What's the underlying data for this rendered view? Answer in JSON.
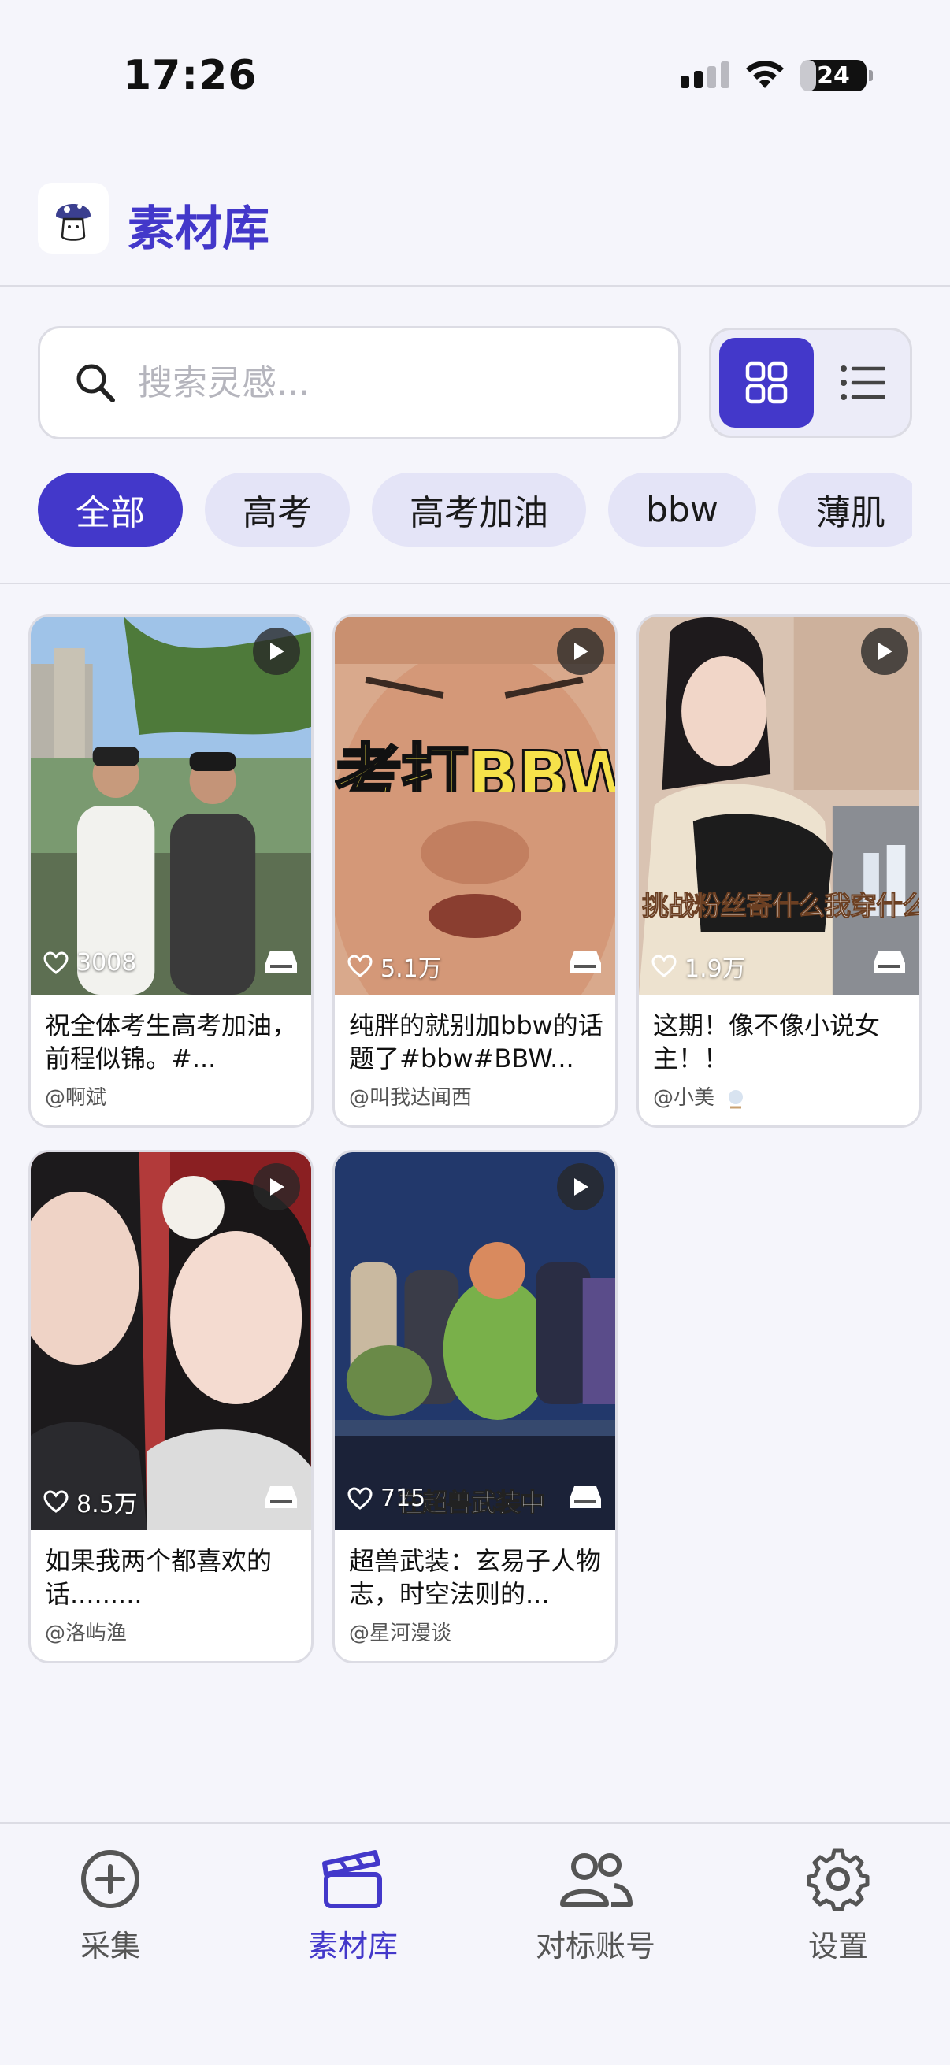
{
  "status_bar": {
    "time": "17:26",
    "battery": "24",
    "battery_level": 0.24
  },
  "header": {
    "title": "素材库"
  },
  "search": {
    "placeholder": "搜索灵感..."
  },
  "filters": [
    {
      "label": "全部",
      "active": true
    },
    {
      "label": "高考",
      "active": false
    },
    {
      "label": "高考加油",
      "active": false
    },
    {
      "label": "bbw",
      "active": false
    },
    {
      "label": "薄肌",
      "active": false
    }
  ],
  "cards": [
    {
      "likes": "3008",
      "title": "祝全体考生高考加油，前程似锦。#...",
      "author": "@啊斌"
    },
    {
      "likes": "5.1万",
      "title": "纯胖的就别加bbw的话题了#bbw#BBW...",
      "author": "@叫我达闻西",
      "overlay": "考打BBW"
    },
    {
      "likes": "1.9万",
      "title": "这期！像不像小说女主！！",
      "author": "@小美",
      "overlay": "挑战粉丝寄什么我穿什么"
    },
    {
      "likes": "8.5万",
      "title": "如果我两个都喜欢的话.........",
      "author": "@洛屿渔"
    },
    {
      "likes": "715",
      "title": "超兽武装：玄易子人物志，时空法则的...",
      "author": "@星河漫谈",
      "overlay": "在超兽武装中"
    }
  ],
  "nav": [
    {
      "label": "采集",
      "icon": "plus-circle-icon",
      "active": false
    },
    {
      "label": "素材库",
      "icon": "clapperboard-icon",
      "active": true
    },
    {
      "label": "对标账号",
      "icon": "users-icon",
      "active": false
    },
    {
      "label": "设置",
      "icon": "gear-icon",
      "active": false
    }
  ],
  "colors": {
    "accent": "#4338ca",
    "chip_bg": "#e4e4f7",
    "background": "#f5f5fb"
  }
}
